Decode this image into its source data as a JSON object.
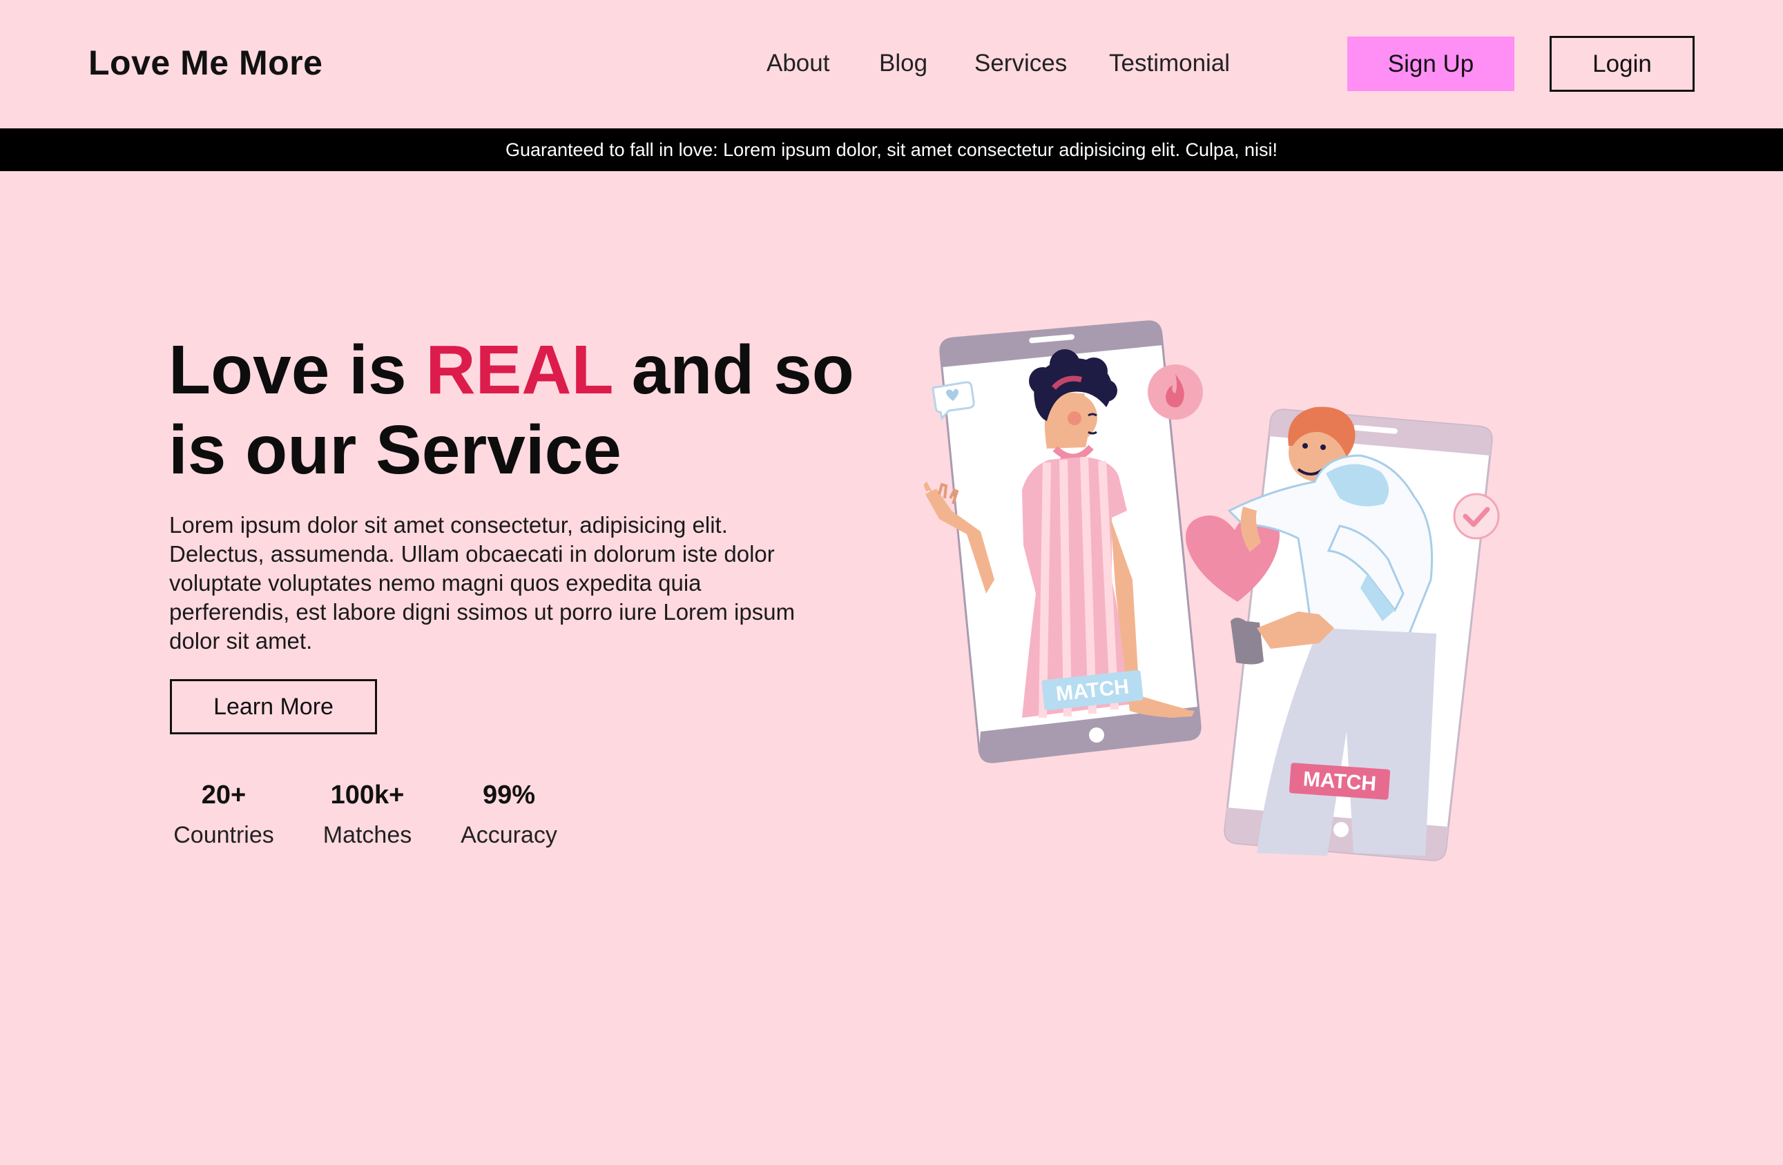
{
  "header": {
    "logo": "Love Me More",
    "nav": [
      "About",
      "Blog",
      "Services",
      "Testimonial"
    ],
    "signup_label": "Sign Up",
    "login_label": "Login"
  },
  "banner": {
    "text": "Guaranteed to fall in love: Lorem ipsum dolor, sit amet consectetur adipisicing elit. Culpa, nisi!"
  },
  "hero": {
    "title_part1": "Love is ",
    "title_accent": "REAL",
    "title_part2": " and so is our Service",
    "description": "Lorem ipsum dolor sit amet consectetur, adipisicing elit. Delectus, assumenda. Ullam obcaecati in dolorum iste dolor voluptate voluptates nemo magni quos expedita quia perferendis, est labore digni ssimos ut porro iure Lorem ipsum dolor sit amet.",
    "cta_label": "Learn More",
    "stats": [
      {
        "value": "20+",
        "label": "Countries"
      },
      {
        "value": "100k+",
        "label": "Matches"
      },
      {
        "value": "99%",
        "label": "Accuracy"
      }
    ]
  },
  "illustration": {
    "badge_left": "MATCH",
    "badge_right": "MATCH"
  },
  "colors": {
    "background": "#ffd9e0",
    "accent": "#dc1c4b",
    "signup": "#ff8ef5"
  }
}
